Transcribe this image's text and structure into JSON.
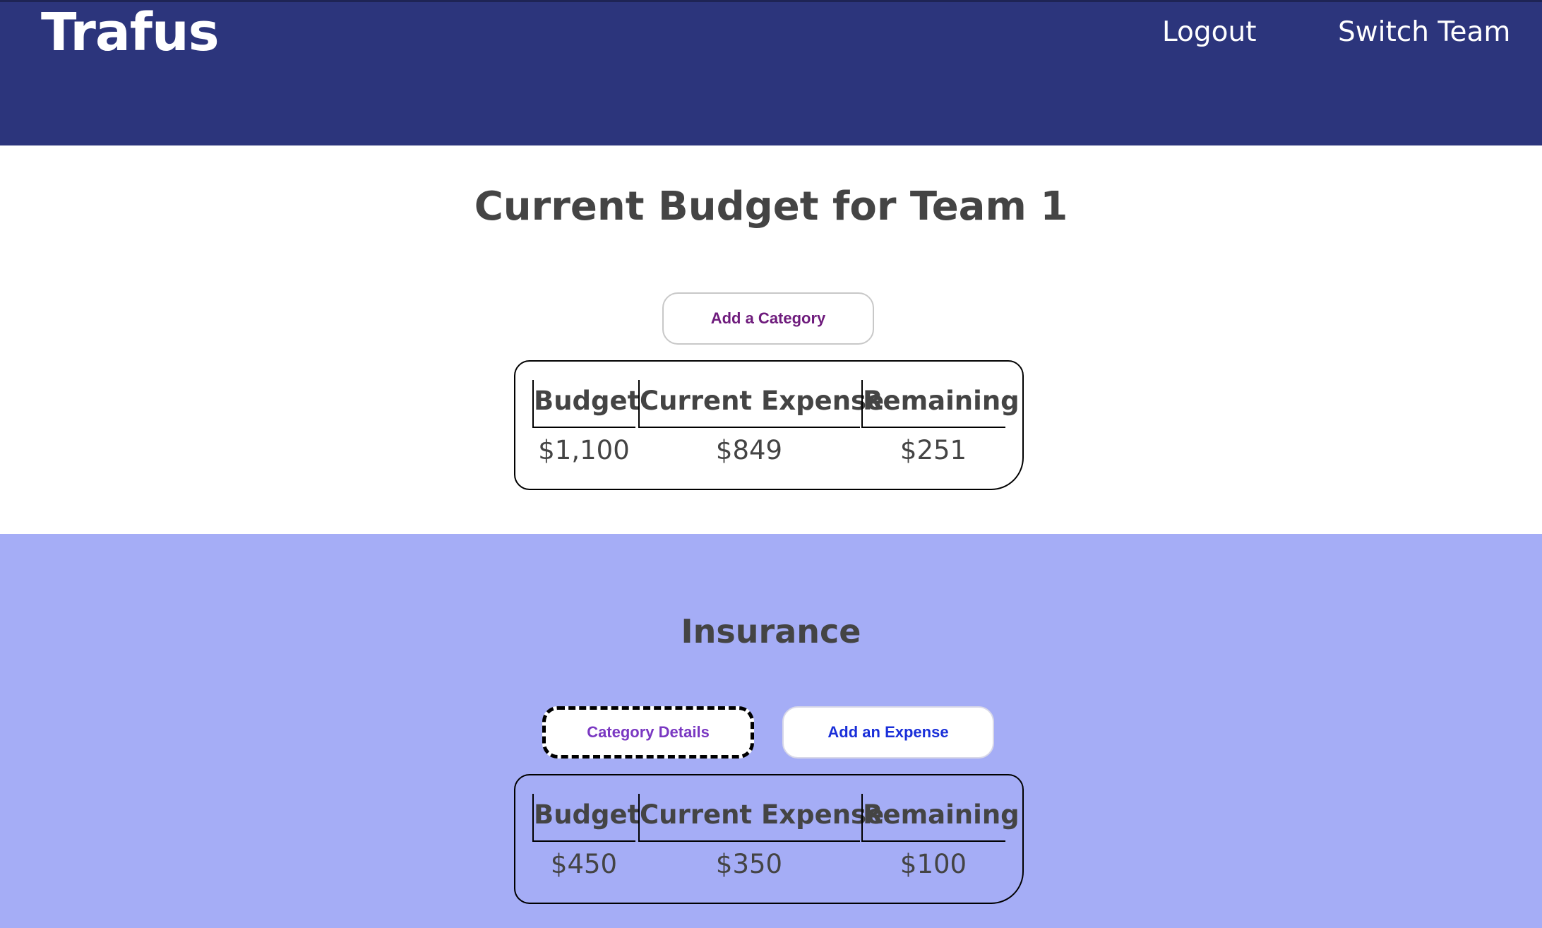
{
  "navbar": {
    "brand": "Trafus",
    "links": {
      "logout": "Logout",
      "switch_team": "Switch Team"
    },
    "background_color": "#2c357c"
  },
  "overview": {
    "title": "Current Budget for Team 1",
    "add_category_label": "Add a Category",
    "table": {
      "headers": [
        "Budget",
        "Current Expense",
        "Remaining"
      ],
      "values": [
        "$1,100",
        "$849",
        "$251"
      ]
    }
  },
  "categories": [
    {
      "name": "Insurance",
      "details_label": "Category Details",
      "add_expense_label": "Add an Expense",
      "table": {
        "headers": [
          "Budget",
          "Current Expense",
          "Remaining"
        ],
        "values": [
          "$450",
          "$350",
          "$100"
        ]
      },
      "background_color": "#a5adf6"
    }
  ]
}
